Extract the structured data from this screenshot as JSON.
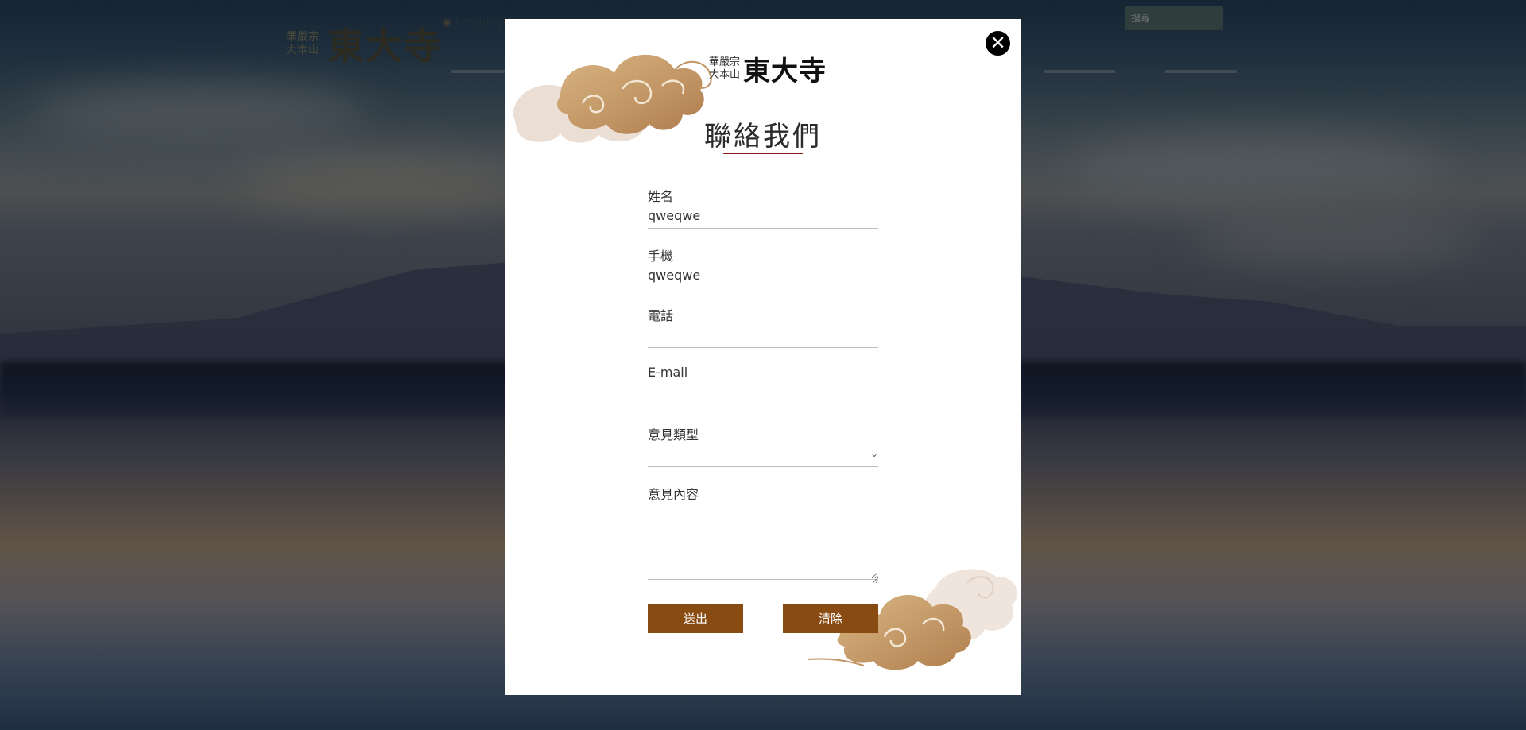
{
  "site": {
    "logo_small_1": "華嚴宗",
    "logo_small_2": "大本山",
    "logo_big": "東大寺",
    "lang": "Language",
    "search_placeholder": "搜尋"
  },
  "modal": {
    "close_symbol": "✕",
    "brand_sub_1": "華嚴宗",
    "brand_sub_2": "大本山",
    "brand_name": "東大寺",
    "title": "聯絡我們"
  },
  "form": {
    "name_label": "姓名",
    "name_value": "qweqwe",
    "mobile_label": "手機",
    "mobile_value": "qweqwe",
    "phone_label": "電話",
    "phone_value": "",
    "email_label": "E-mail",
    "email_value": "",
    "type_label": "意見類型",
    "type_value": "",
    "content_label": "意見內容",
    "content_value": "",
    "submit_label": "送出",
    "clear_label": "清除"
  },
  "colors": {
    "accent": "#884c13",
    "underline": "#8b1c1c",
    "close_bg": "#000000"
  }
}
